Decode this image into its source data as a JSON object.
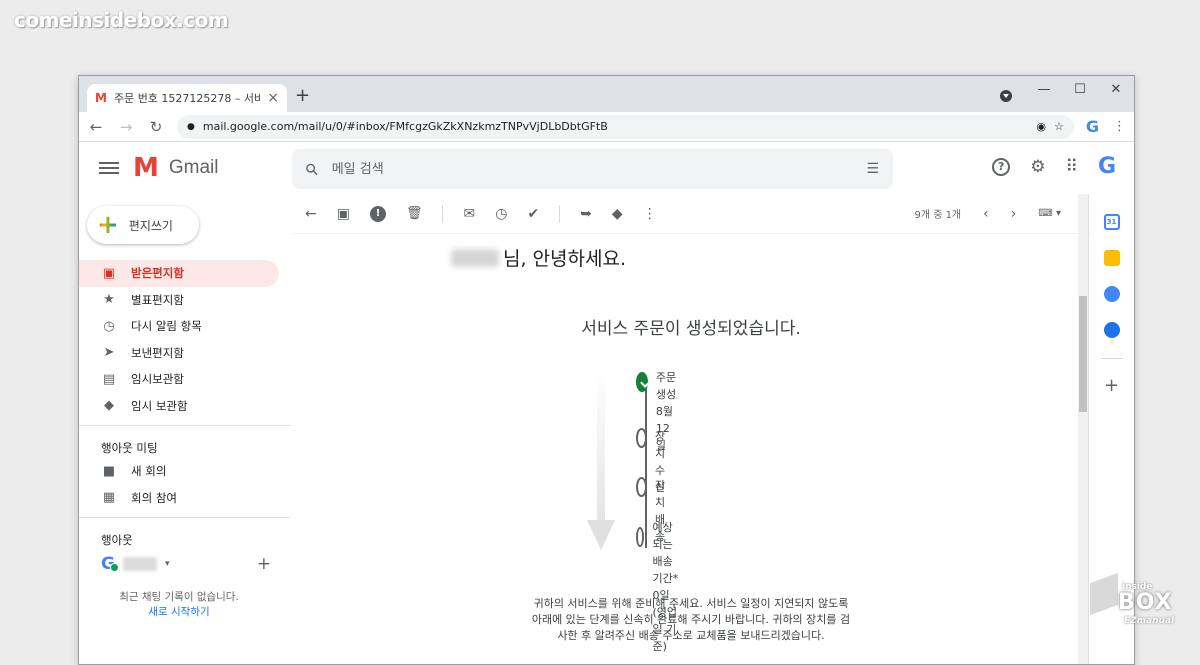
{
  "watermark": "comeinsidebox.com",
  "browser": {
    "tab_title": "주문 번호 1527125278 – 서비스 ",
    "tab_close": "×",
    "new_tab": "+",
    "url": "mail.google.com/mail/u/0/#inbox/FMfcgzGkZkXNzkmzTNPvVjDLbDbtGFtB",
    "win_minimize": "—",
    "win_maximize": "☐",
    "win_close": "✕",
    "nav_back": "←",
    "nav_forward": "→",
    "nav_reload": "↻",
    "lock": "🔒",
    "eye": "◉",
    "star": "☆",
    "profile": "G",
    "menu": "⋮"
  },
  "gmail": {
    "brand": "Gmail",
    "brand_mark": "M",
    "search_placeholder": "메일 검색",
    "search_icon": "⚲",
    "tune_icon": "☰",
    "help_icon": "?",
    "settings_icon": "⚙",
    "apps_icon": "⠿",
    "account_letter": "G",
    "compose_label": "편지쓰기",
    "compose_plus": "+",
    "nav": [
      {
        "label": "받은편지함",
        "icon": "▣"
      },
      {
        "label": "별표편지함",
        "icon": "★"
      },
      {
        "label": "다시 알림 항목",
        "icon": "◷"
      },
      {
        "label": "보낸편지함",
        "icon": "➤"
      },
      {
        "label": "임시보관함",
        "icon": "▤"
      },
      {
        "label": "임시 보관함",
        "icon": "◆"
      }
    ],
    "meet_title": "행아웃 미팅",
    "meet": [
      {
        "label": "새 회의",
        "icon": "■"
      },
      {
        "label": "회의 참여",
        "icon": "▦"
      }
    ],
    "hangouts_title": "행아웃",
    "hangouts_add": "+",
    "hangouts_caret": "▾",
    "chat_empty": "최근 채팅 기록이 없습니다.",
    "chat_start": "새로 시작하기",
    "actions": {
      "back": "←",
      "archive": "▣",
      "spam": "!",
      "delete": "🗑",
      "mark": "✉",
      "snooze": "◷",
      "task": "✔",
      "move": "➥",
      "label": "◆",
      "more": "⋮",
      "count": "9개 중 1개",
      "prev": "‹",
      "next": "›",
      "keyboard": "⌨ ▾"
    }
  },
  "email": {
    "greeting": "님, 안녕하세요.",
    "headline": "서비스 주문이 생성되었습니다.",
    "steps": [
      {
        "title": "주문 생성",
        "sub": "8월 12일",
        "done": true
      },
      {
        "title": "장치 수신",
        "sub": "",
        "done": false
      },
      {
        "title": "장치 배송",
        "sub": "",
        "done": false
      },
      {
        "title": "예상되는 배송 기간*",
        "sub": "0일(영업일 기준)",
        "done": false
      }
    ],
    "footer_line1": "귀하의 서비스를 위해 준비해 주세요. 서비스 일정이 지연되지 않도록",
    "footer_line2": "아래에 있는 단계를 신속히 완료해 주시기 바랍니다. 귀하의 장치를 검",
    "footer_line3": "사한 후 알려주신 배송 주소로 교체품을 보내드리겠습니다."
  },
  "rightpanel": {
    "calendar_day": "31",
    "add": "+"
  },
  "boxlogo": {
    "line1": "inside",
    "line2": "BOX",
    "line3": "EZmanual"
  }
}
